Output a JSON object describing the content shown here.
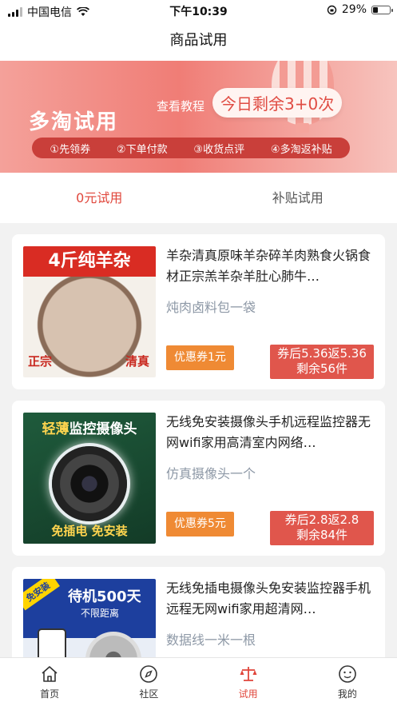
{
  "status_bar": {
    "carrier": "中国电信",
    "time": "下午10:39",
    "battery": "29%"
  },
  "nav": {
    "title": "商品试用"
  },
  "banner": {
    "brand": "多淘试用",
    "tutorial": "查看教程",
    "remaining": "今日剩余3+0次",
    "steps": [
      "①先领券",
      "②下单付款",
      "③收货点评",
      "④多淘返补贴"
    ]
  },
  "tabs": [
    {
      "label": "0元试用",
      "active": true
    },
    {
      "label": "补贴试用",
      "active": false
    }
  ],
  "products": [
    {
      "thumb_text": {
        "ribbon": "4斤纯羊杂",
        "left": "正宗",
        "right": "清真"
      },
      "title": "羊杂清真原味羊杂碎羊肉熟食火锅食材正宗羔羊杂羊肚心肺牛…",
      "gift": "炖肉卤料包一袋",
      "coupon": "优惠券1元",
      "after_line1": "券后5.36返5.36",
      "after_line2": "剩余56件"
    },
    {
      "thumb_text": {
        "top_hl": "轻薄",
        "top": "监控摄像头",
        "bottom": "免插电 免安装"
      },
      "title": "无线免安装摄像头手机远程监控器无网wifi家用高清室内网络…",
      "gift": "仿真摄像头一个",
      "coupon": "优惠券5元",
      "after_line1": "券后2.8返2.8",
      "after_line2": "剩余84件"
    },
    {
      "thumb_text": {
        "badge": "免安装",
        "top": "待机500天",
        "sub": "不限距离"
      },
      "title": "无线免插电摄像头免安装监控器手机远程无网wifi家用超清网…",
      "gift": "数据线一米一根"
    }
  ],
  "tab_bar": [
    {
      "label": "首页",
      "icon": "home-icon"
    },
    {
      "label": "社区",
      "icon": "compass-icon"
    },
    {
      "label": "试用",
      "icon": "scale-icon",
      "active": true
    },
    {
      "label": "我的",
      "icon": "face-icon"
    }
  ],
  "colors": {
    "accent": "#e0463b",
    "coupon": "#ef8a34",
    "after": "#e0564c"
  }
}
